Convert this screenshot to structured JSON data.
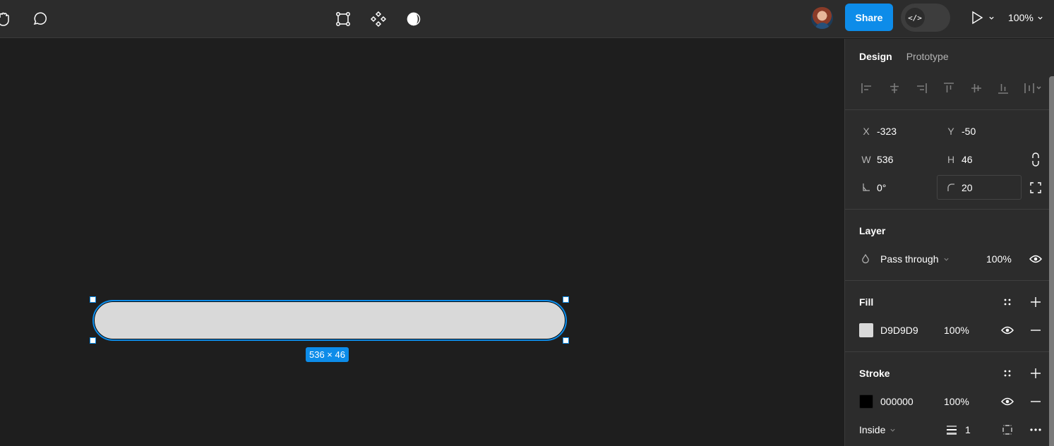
{
  "toolbar": {
    "left_tools": [
      {
        "name": "hand-tool",
        "icon": "hand-icon"
      },
      {
        "name": "comment-tool",
        "icon": "comment-icon"
      }
    ],
    "center_tools": [
      {
        "name": "frame-tool",
        "icon": "frame-icon"
      },
      {
        "name": "component-tool",
        "icon": "component-icon"
      },
      {
        "name": "contrast-tool",
        "icon": "contrast-icon"
      }
    ],
    "share_label": "Share",
    "dev_mode_icon": "</>",
    "zoom_label": "100%"
  },
  "canvas": {
    "selected_shape": {
      "fill": "#D9D9D9",
      "stroke": "#000000",
      "dimension_label": "536 × 46"
    },
    "selection_color": "#0D8CE9"
  },
  "panel": {
    "tabs": [
      {
        "label": "Design",
        "active": true
      },
      {
        "label": "Prototype",
        "active": false
      }
    ],
    "align_icons": [
      "align-left-icon",
      "align-horizontal-center-icon",
      "align-right-icon",
      "align-top-icon",
      "align-vertical-center-icon",
      "align-bottom-icon",
      "distribute-icon"
    ],
    "position": {
      "x_label": "X",
      "x": "-323",
      "y_label": "Y",
      "y": "-50",
      "w_label": "W",
      "w": "536",
      "h_label": "H",
      "h": "46",
      "rotation": "0°",
      "corner_radius": "20"
    },
    "layer": {
      "title": "Layer",
      "blend_mode": "Pass through",
      "opacity": "100%"
    },
    "fill": {
      "title": "Fill",
      "hex": "D9D9D9",
      "color": "#D9D9D9",
      "opacity": "100%"
    },
    "stroke": {
      "title": "Stroke",
      "hex": "000000",
      "color": "#000000",
      "opacity": "100%",
      "position": "Inside",
      "weight": "1"
    }
  }
}
